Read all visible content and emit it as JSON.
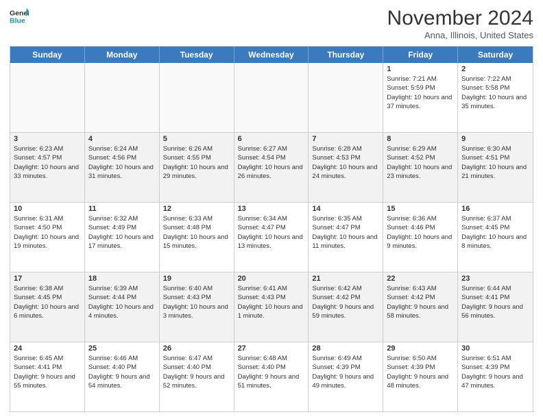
{
  "logo": {
    "line1": "General",
    "line2": "Blue"
  },
  "title": "November 2024",
  "location": "Anna, Illinois, United States",
  "weekdays": [
    "Sunday",
    "Monday",
    "Tuesday",
    "Wednesday",
    "Thursday",
    "Friday",
    "Saturday"
  ],
  "rows": [
    [
      {
        "day": "",
        "info": "",
        "empty": true
      },
      {
        "day": "",
        "info": "",
        "empty": true
      },
      {
        "day": "",
        "info": "",
        "empty": true
      },
      {
        "day": "",
        "info": "",
        "empty": true
      },
      {
        "day": "",
        "info": "",
        "empty": true
      },
      {
        "day": "1",
        "info": "Sunrise: 7:21 AM\nSunset: 5:59 PM\nDaylight: 10 hours and 37 minutes."
      },
      {
        "day": "2",
        "info": "Sunrise: 7:22 AM\nSunset: 5:58 PM\nDaylight: 10 hours and 35 minutes."
      }
    ],
    [
      {
        "day": "3",
        "info": "Sunrise: 6:23 AM\nSunset: 4:57 PM\nDaylight: 10 hours and 33 minutes."
      },
      {
        "day": "4",
        "info": "Sunrise: 6:24 AM\nSunset: 4:56 PM\nDaylight: 10 hours and 31 minutes."
      },
      {
        "day": "5",
        "info": "Sunrise: 6:26 AM\nSunset: 4:55 PM\nDaylight: 10 hours and 29 minutes."
      },
      {
        "day": "6",
        "info": "Sunrise: 6:27 AM\nSunset: 4:54 PM\nDaylight: 10 hours and 26 minutes."
      },
      {
        "day": "7",
        "info": "Sunrise: 6:28 AM\nSunset: 4:53 PM\nDaylight: 10 hours and 24 minutes."
      },
      {
        "day": "8",
        "info": "Sunrise: 6:29 AM\nSunset: 4:52 PM\nDaylight: 10 hours and 23 minutes."
      },
      {
        "day": "9",
        "info": "Sunrise: 6:30 AM\nSunset: 4:51 PM\nDaylight: 10 hours and 21 minutes."
      }
    ],
    [
      {
        "day": "10",
        "info": "Sunrise: 6:31 AM\nSunset: 4:50 PM\nDaylight: 10 hours and 19 minutes."
      },
      {
        "day": "11",
        "info": "Sunrise: 6:32 AM\nSunset: 4:49 PM\nDaylight: 10 hours and 17 minutes."
      },
      {
        "day": "12",
        "info": "Sunrise: 6:33 AM\nSunset: 4:48 PM\nDaylight: 10 hours and 15 minutes."
      },
      {
        "day": "13",
        "info": "Sunrise: 6:34 AM\nSunset: 4:47 PM\nDaylight: 10 hours and 13 minutes."
      },
      {
        "day": "14",
        "info": "Sunrise: 6:35 AM\nSunset: 4:47 PM\nDaylight: 10 hours and 11 minutes."
      },
      {
        "day": "15",
        "info": "Sunrise: 6:36 AM\nSunset: 4:46 PM\nDaylight: 10 hours and 9 minutes."
      },
      {
        "day": "16",
        "info": "Sunrise: 6:37 AM\nSunset: 4:45 PM\nDaylight: 10 hours and 8 minutes."
      }
    ],
    [
      {
        "day": "17",
        "info": "Sunrise: 6:38 AM\nSunset: 4:45 PM\nDaylight: 10 hours and 6 minutes."
      },
      {
        "day": "18",
        "info": "Sunrise: 6:39 AM\nSunset: 4:44 PM\nDaylight: 10 hours and 4 minutes."
      },
      {
        "day": "19",
        "info": "Sunrise: 6:40 AM\nSunset: 4:43 PM\nDaylight: 10 hours and 3 minutes."
      },
      {
        "day": "20",
        "info": "Sunrise: 6:41 AM\nSunset: 4:43 PM\nDaylight: 10 hours and 1 minute."
      },
      {
        "day": "21",
        "info": "Sunrise: 6:42 AM\nSunset: 4:42 PM\nDaylight: 9 hours and 59 minutes."
      },
      {
        "day": "22",
        "info": "Sunrise: 6:43 AM\nSunset: 4:42 PM\nDaylight: 9 hours and 58 minutes."
      },
      {
        "day": "23",
        "info": "Sunrise: 6:44 AM\nSunset: 4:41 PM\nDaylight: 9 hours and 56 minutes."
      }
    ],
    [
      {
        "day": "24",
        "info": "Sunrise: 6:45 AM\nSunset: 4:41 PM\nDaylight: 9 hours and 55 minutes."
      },
      {
        "day": "25",
        "info": "Sunrise: 6:46 AM\nSunset: 4:40 PM\nDaylight: 9 hours and 54 minutes."
      },
      {
        "day": "26",
        "info": "Sunrise: 6:47 AM\nSunset: 4:40 PM\nDaylight: 9 hours and 52 minutes."
      },
      {
        "day": "27",
        "info": "Sunrise: 6:48 AM\nSunset: 4:40 PM\nDaylight: 9 hours and 51 minutes."
      },
      {
        "day": "28",
        "info": "Sunrise: 6:49 AM\nSunset: 4:39 PM\nDaylight: 9 hours and 49 minutes."
      },
      {
        "day": "29",
        "info": "Sunrise: 6:50 AM\nSunset: 4:39 PM\nDaylight: 9 hours and 48 minutes."
      },
      {
        "day": "30",
        "info": "Sunrise: 6:51 AM\nSunset: 4:39 PM\nDaylight: 9 hours and 47 minutes."
      }
    ]
  ]
}
